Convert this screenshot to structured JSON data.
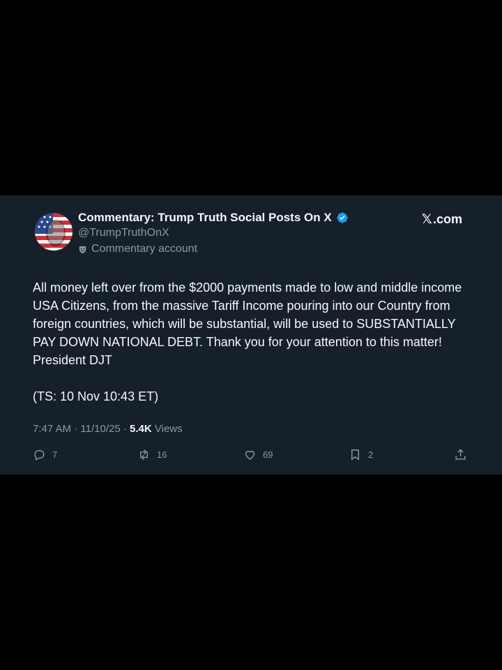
{
  "tweet": {
    "display_name": "Commentary: Trump Truth Social Posts On X",
    "handle": "@TrumpTruthOnX",
    "commentary_label": "Commentary account",
    "site_x": "𝕏",
    "site_suffix": ".com",
    "body": "All money left over from the $2000 payments made to low and middle income USA Citizens, from the massive Tariff Income pouring into our Country from foreign countries, which will be substantial, will be used to SUBSTANTIALLY PAY DOWN NATIONAL DEBT. Thank you for your attention to this matter! President DJT\n\n(TS: 10 Nov 10:43 ET)",
    "time": "7:47 AM",
    "date": "11/10/25",
    "views_count": "5.4K",
    "views_label": "Views"
  },
  "actions": {
    "replies": "7",
    "retweets": "16",
    "likes": "69",
    "bookmarks": "2"
  },
  "colors": {
    "card_bg": "#15202b",
    "text": "#f7f9f9",
    "muted": "#8b98a5",
    "verified": "#1d9bf0"
  },
  "icons": [
    "verified-badge-icon",
    "commentary-mask-icon",
    "reply-icon",
    "retweet-icon",
    "like-icon",
    "bookmark-icon",
    "share-icon"
  ]
}
